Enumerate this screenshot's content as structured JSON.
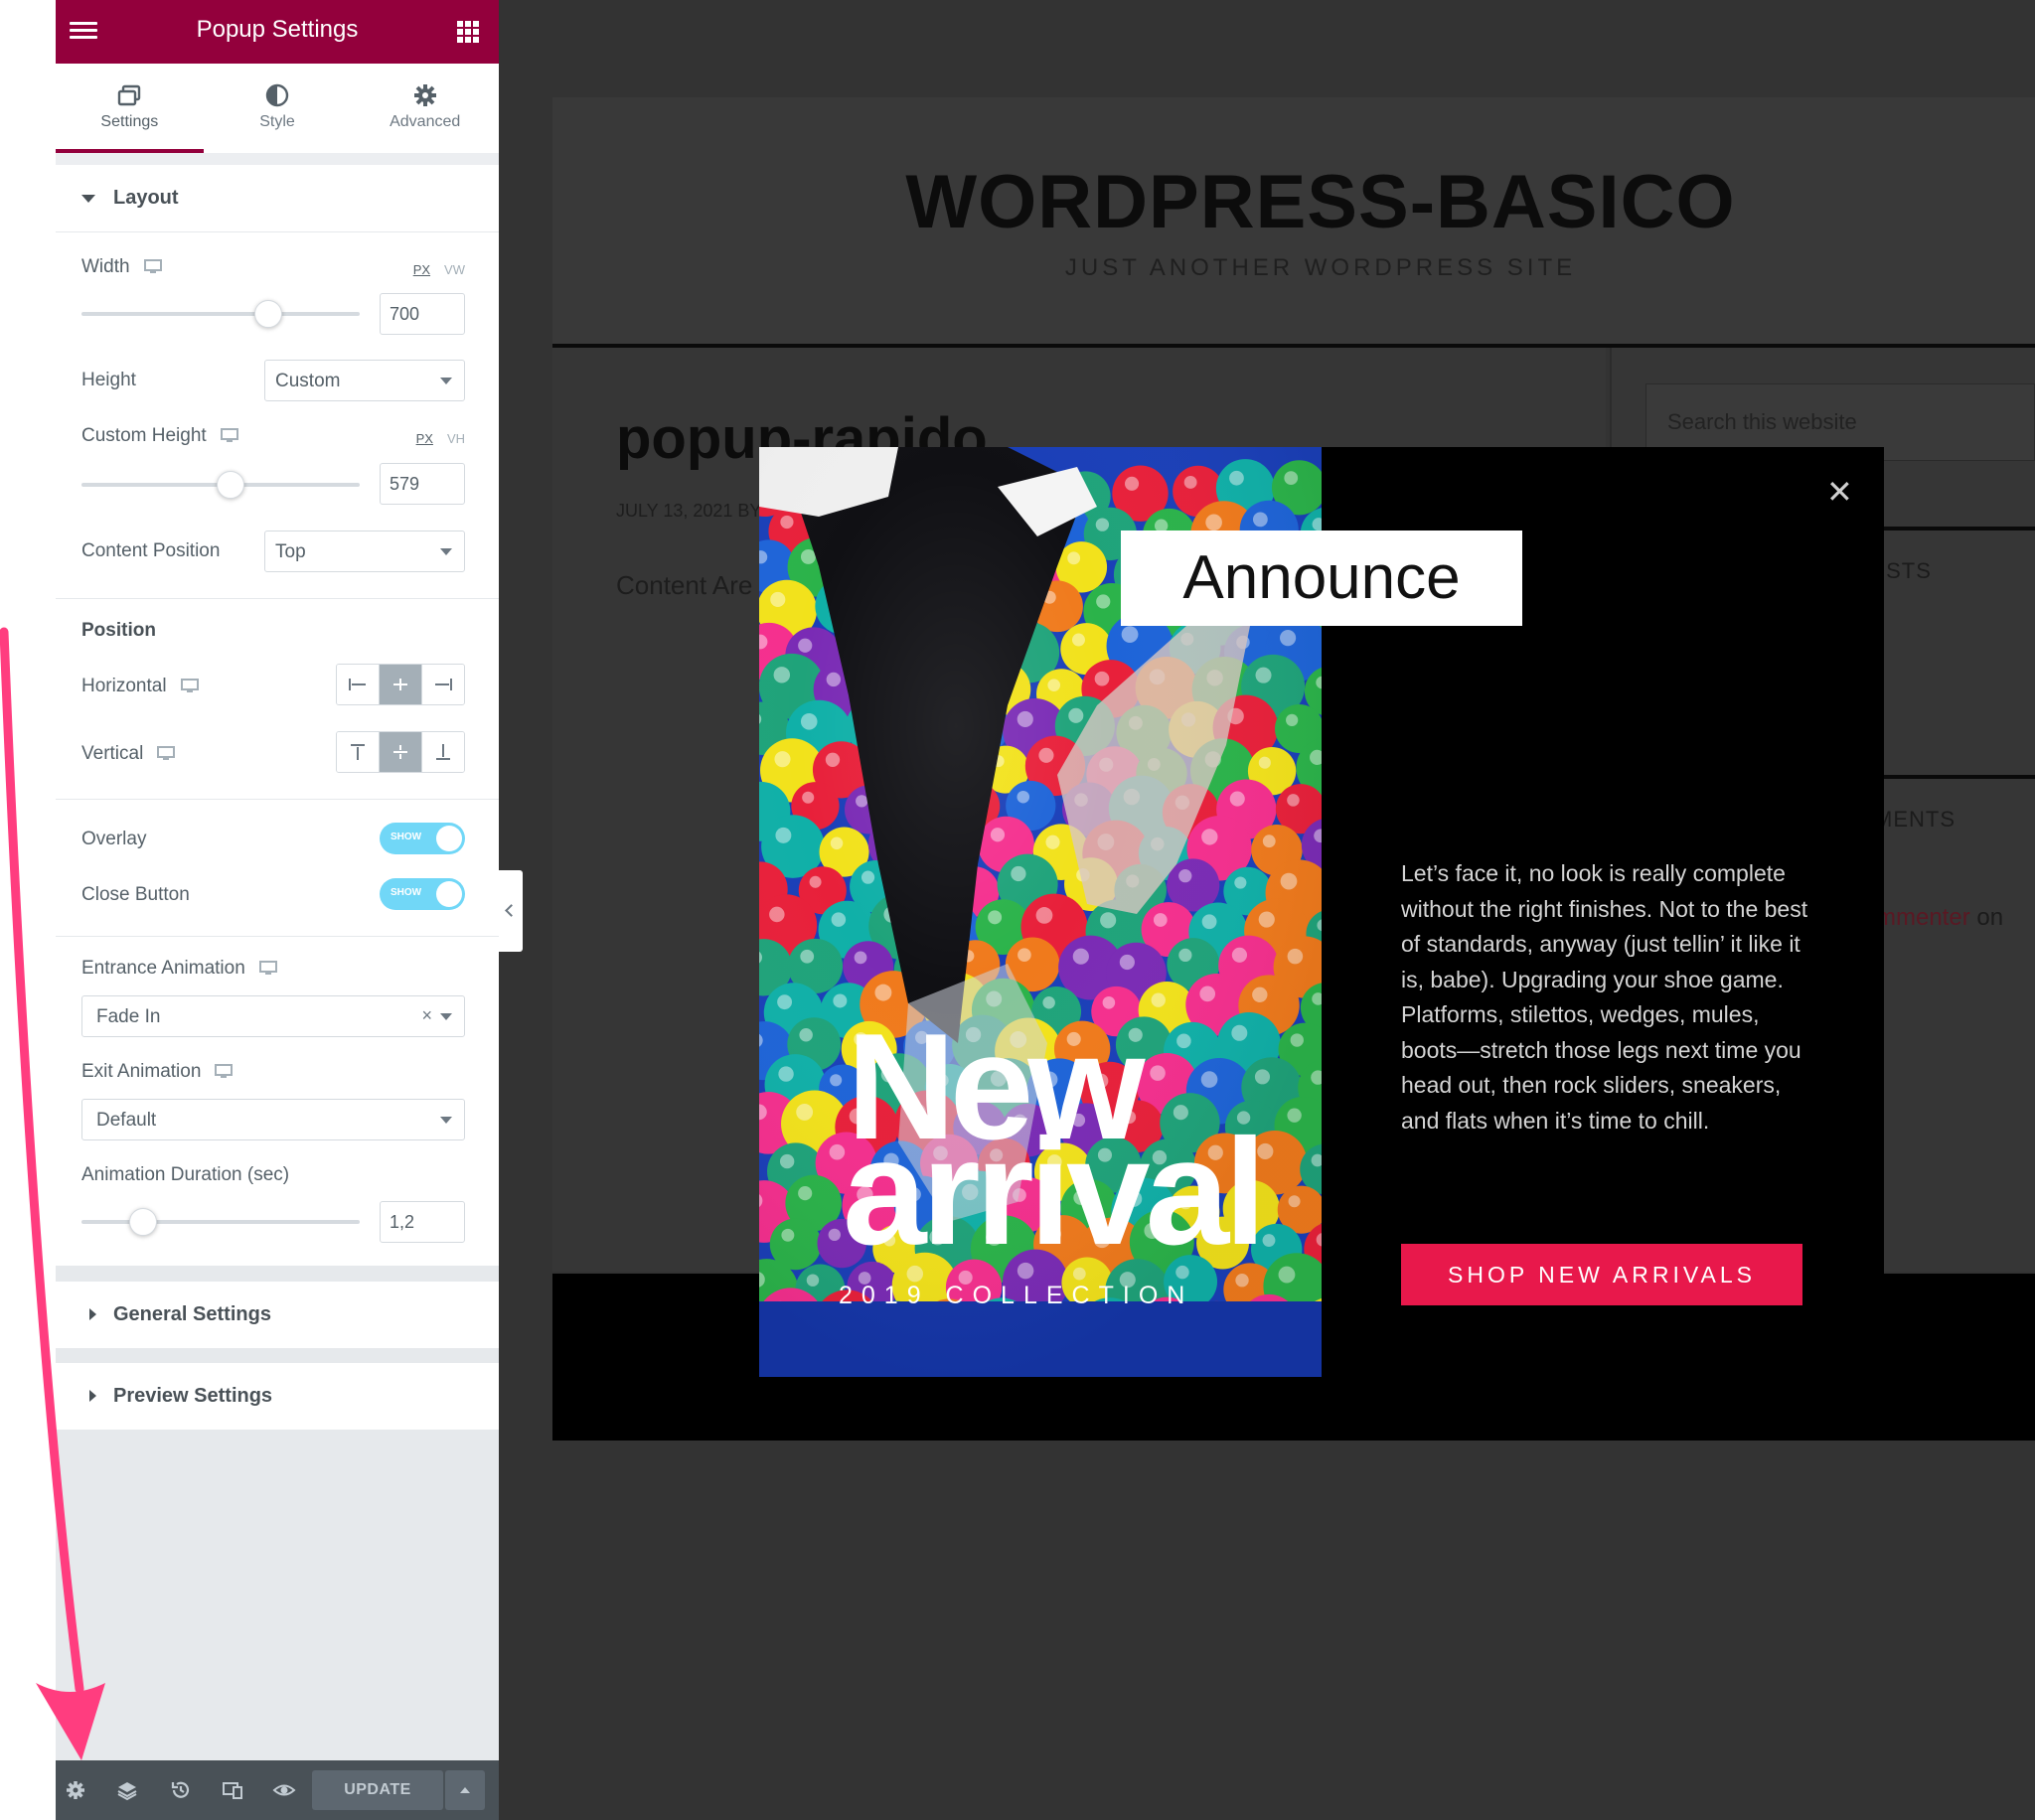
{
  "panel": {
    "title": "Popup Settings",
    "tabs": [
      {
        "label": "Settings",
        "icon": "window-stack-icon"
      },
      {
        "label": "Style",
        "icon": "half-circle-icon"
      },
      {
        "label": "Advanced",
        "icon": "gear-icon"
      }
    ],
    "active_tab": "Settings",
    "accent_color": "#93003c"
  },
  "layout": {
    "title": "Layout",
    "width": {
      "label": "Width",
      "units": [
        "PX",
        "VW"
      ],
      "active_unit": "PX",
      "value": "700",
      "slider_fraction": 0.67
    },
    "height": {
      "label": "Height",
      "value": "Custom"
    },
    "custom_height": {
      "label": "Custom Height",
      "units": [
        "PX",
        "VH"
      ],
      "active_unit": "PX",
      "value": "579",
      "slider_fraction": 0.53
    },
    "content_position": {
      "label": "Content Position",
      "value": "Top"
    },
    "position_title": "Position",
    "horizontal": {
      "label": "Horizontal",
      "selected": "center"
    },
    "vertical": {
      "label": "Vertical",
      "selected": "middle"
    },
    "overlay": {
      "label": "Overlay",
      "state": "SHOW"
    },
    "close_button": {
      "label": "Close Button",
      "state": "SHOW"
    },
    "entrance_animation": {
      "label": "Entrance Animation",
      "value": "Fade In",
      "clear": "×"
    },
    "exit_animation": {
      "label": "Exit Animation",
      "value": "Default"
    },
    "animation_duration": {
      "label": "Animation Duration (sec)",
      "value": "1,2",
      "slider_fraction": 0.2
    }
  },
  "sections": {
    "general": "General Settings",
    "preview": "Preview Settings"
  },
  "footer": {
    "update_label": "UPDATE",
    "icons": [
      "gear-icon",
      "layers-icon",
      "history-icon",
      "responsive-icon",
      "eye-icon"
    ]
  },
  "site": {
    "title": "WORDPRESS-BASICO",
    "tagline": "JUST ANOTHER WORDPRESS SITE",
    "post_title": "popup-rapido",
    "post_meta": "JULY 13, 2021 BY",
    "post_content": "Content Are",
    "search_placeholder": "Search this website",
    "sidebar_heading_1": "OSTS",
    "sidebar_heading_2": "MENTS",
    "sidebar_link": "mmenter",
    "sidebar_link_suffix": " on"
  },
  "popup": {
    "announce": "Announce",
    "image_text_1": "New",
    "image_text_2": "arrival",
    "image_text_3": "2019 COLLECTION",
    "body": "Let’s face it, no look is really complete without the right finishes. Not to the best of standards, anyway (just tellin’ it like it is, babe). Upgrading your shoe game. Platforms, stilettos, wedges, mules, boots—stretch those legs next time you head out, then rock sliders, sneakers, and flats when it’s time to chill.",
    "button": "SHOP NEW ARRIVALS",
    "close": "✕",
    "button_color": "#e8184b"
  },
  "annotation": {
    "arrow_color": "#ff3d7f"
  }
}
